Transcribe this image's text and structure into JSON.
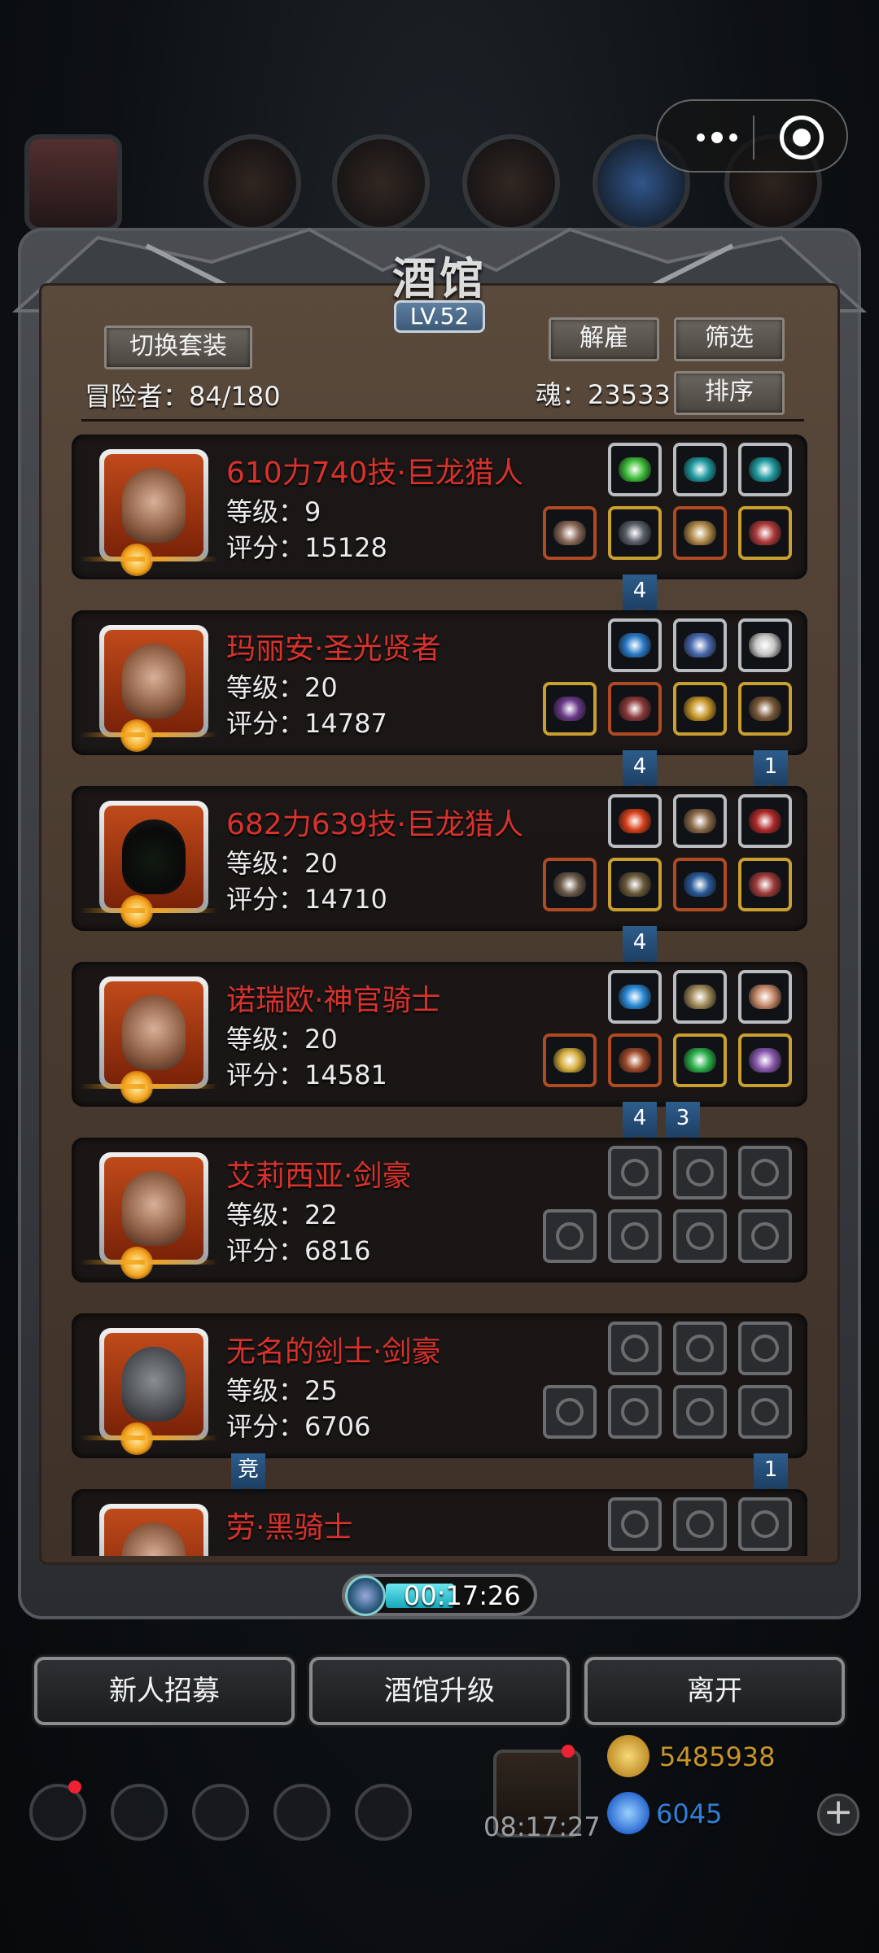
{
  "title": "酒馆",
  "level": "LV.52",
  "buttons": {
    "switch_outfit": "切换套装",
    "dismiss": "解雇",
    "filter": "筛选",
    "sort": "排序"
  },
  "adventurers": "冒险者：84/180",
  "soul": "魂：23533",
  "heroes": [
    {
      "name": "610力740技·巨龙猎人",
      "level": "等级：9",
      "score": "评分：15128",
      "slots_top": [
        {
          "icon": "green-crystal-icon",
          "rarity": "silver",
          "color": "#3fbf3a"
        },
        {
          "icon": "teal-gem-icon",
          "rarity": "silver",
          "color": "#1f9aa0"
        },
        {
          "icon": "teal-gem-icon",
          "rarity": "silver",
          "color": "#1f9aa0"
        }
      ],
      "slots_bottom": [
        {
          "icon": "crossbow-icon",
          "rarity": "red",
          "color": "#8a6a5a"
        },
        {
          "icon": "armor-icon",
          "rarity": "gold",
          "color": "#5a5f6a"
        },
        {
          "icon": "amulet-icon",
          "rarity": "red",
          "color": "#b08a4a"
        },
        {
          "icon": "heart-pendant-icon",
          "rarity": "gold",
          "color": "#b03a3a"
        }
      ],
      "tags": [
        {
          "text": "4"
        }
      ]
    },
    {
      "name": "玛丽安·圣光贤者",
      "level": "等级：20",
      "score": "评分：14787",
      "slots_top": [
        {
          "icon": "blue-orb-icon",
          "rarity": "silver",
          "color": "#2a7ac8"
        },
        {
          "icon": "potion-icon",
          "rarity": "silver",
          "color": "#4a6ab0"
        },
        {
          "icon": "claw-icon",
          "rarity": "silver",
          "color": "#c8c8c8"
        }
      ],
      "slots_bottom": [
        {
          "icon": "staff-icon",
          "rarity": "gold",
          "color": "#6a3a8a"
        },
        {
          "icon": "robe-icon",
          "rarity": "red",
          "color": "#8a3a3a"
        },
        {
          "icon": "ring-icon",
          "rarity": "gold",
          "color": "#c8962a"
        },
        {
          "icon": "mask-icon",
          "rarity": "gold",
          "color": "#7a5a3a"
        }
      ],
      "tags": [
        {
          "text": "4"
        },
        {
          "text": "1"
        }
      ]
    },
    {
      "name": "682力639技·巨龙猎人",
      "level": "等级：20",
      "score": "评分：14710",
      "slots_top": [
        {
          "icon": "flame-icon",
          "rarity": "silver",
          "color": "#d8401a"
        },
        {
          "icon": "bow-icon",
          "rarity": "silver",
          "color": "#8a6a4a"
        },
        {
          "icon": "vortex-icon",
          "rarity": "silver",
          "color": "#b02a2a"
        }
      ],
      "slots_bottom": [
        {
          "icon": "rifle-icon",
          "rarity": "red",
          "color": "#6a5a4a"
        },
        {
          "icon": "chest-armor-icon",
          "rarity": "gold",
          "color": "#6a5a3a"
        },
        {
          "icon": "bracer-icon",
          "rarity": "red",
          "color": "#2a5a9a"
        },
        {
          "icon": "skull-charm-icon",
          "rarity": "gold",
          "color": "#a03a3a"
        }
      ],
      "tags": [
        {
          "text": "4"
        }
      ]
    },
    {
      "name": "诺瑞欧·神官骑士",
      "level": "等级：20",
      "score": "评分：14581",
      "slots_top": [
        {
          "icon": "blue-flame-orb-icon",
          "rarity": "silver",
          "color": "#2a8ad8"
        },
        {
          "icon": "horn-icon",
          "rarity": "silver",
          "color": "#a08a5a"
        },
        {
          "icon": "rune-stone-icon",
          "rarity": "silver",
          "color": "#c88a6a"
        }
      ],
      "slots_bottom": [
        {
          "icon": "hammer-icon",
          "rarity": "red",
          "color": "#d8b040"
        },
        {
          "icon": "plate-armor-icon",
          "rarity": "red",
          "color": "#a04a2a"
        },
        {
          "icon": "emerald-icon",
          "rarity": "gold",
          "color": "#2ab04a"
        },
        {
          "icon": "spider-charm-icon",
          "rarity": "gold",
          "color": "#8a5ab0"
        }
      ],
      "tags": [
        {
          "text": "4"
        },
        {
          "text": "3"
        }
      ]
    },
    {
      "name": "艾莉西亚·剑豪",
      "level": "等级：22",
      "score": "评分：6816",
      "slots_top": [
        {
          "icon": "empty-flame-slot-icon",
          "rarity": "empty",
          "color": "#888888"
        },
        {
          "icon": "empty-hourglass-slot-icon",
          "rarity": "empty",
          "color": "#888888"
        },
        {
          "icon": "empty-hourglass-slot-icon",
          "rarity": "empty",
          "color": "#888888"
        }
      ],
      "slots_bottom": [
        {
          "icon": "empty-sword-slot-icon",
          "rarity": "empty",
          "color": "#888888"
        },
        {
          "icon": "empty-armor-slot-icon",
          "rarity": "empty",
          "color": "#888888"
        },
        {
          "icon": "empty-ring-slot-icon",
          "rarity": "empty",
          "color": "#888888"
        },
        {
          "icon": "empty-ring-slot-icon",
          "rarity": "empty",
          "color": "#888888"
        }
      ],
      "tags": []
    },
    {
      "name": "无名的剑士·剑豪",
      "level": "等级：25",
      "score": "评分：6706",
      "slots_top": [
        {
          "icon": "empty-flame-slot-icon",
          "rarity": "empty",
          "color": "#888888"
        },
        {
          "icon": "empty-hourglass-slot-icon",
          "rarity": "empty",
          "color": "#888888"
        },
        {
          "icon": "empty-hourglass-slot-icon",
          "rarity": "empty",
          "color": "#888888"
        }
      ],
      "slots_bottom": [
        {
          "icon": "empty-sword-slot-icon",
          "rarity": "empty",
          "color": "#888888"
        },
        {
          "icon": "empty-armor-slot-icon",
          "rarity": "empty",
          "color": "#888888"
        },
        {
          "icon": "empty-ring-slot-icon",
          "rarity": "empty",
          "color": "#888888"
        },
        {
          "icon": "empty-ring-slot-icon",
          "rarity": "empty",
          "color": "#888888"
        }
      ],
      "tags": [
        {
          "text": "竞"
        },
        {
          "text": "1"
        }
      ]
    },
    {
      "name": "劳·黑骑士",
      "level": "",
      "score": "",
      "slots_top": [
        {
          "icon": "empty-flame-slot-icon",
          "rarity": "empty",
          "color": "#888888"
        },
        {
          "icon": "empty-hourglass-slot-icon",
          "rarity": "empty",
          "color": "#888888"
        },
        {
          "icon": "empty-hourglass-slot-icon",
          "rarity": "empty",
          "color": "#888888"
        }
      ],
      "slots_bottom": [],
      "tags": []
    }
  ],
  "timer": "00:17:26",
  "actions": {
    "recruit": "新人招募",
    "upgrade": "酒馆升级",
    "leave": "离开"
  },
  "bottom": {
    "gold": "5485938",
    "gems": "6045",
    "clock": "08:17:27"
  }
}
